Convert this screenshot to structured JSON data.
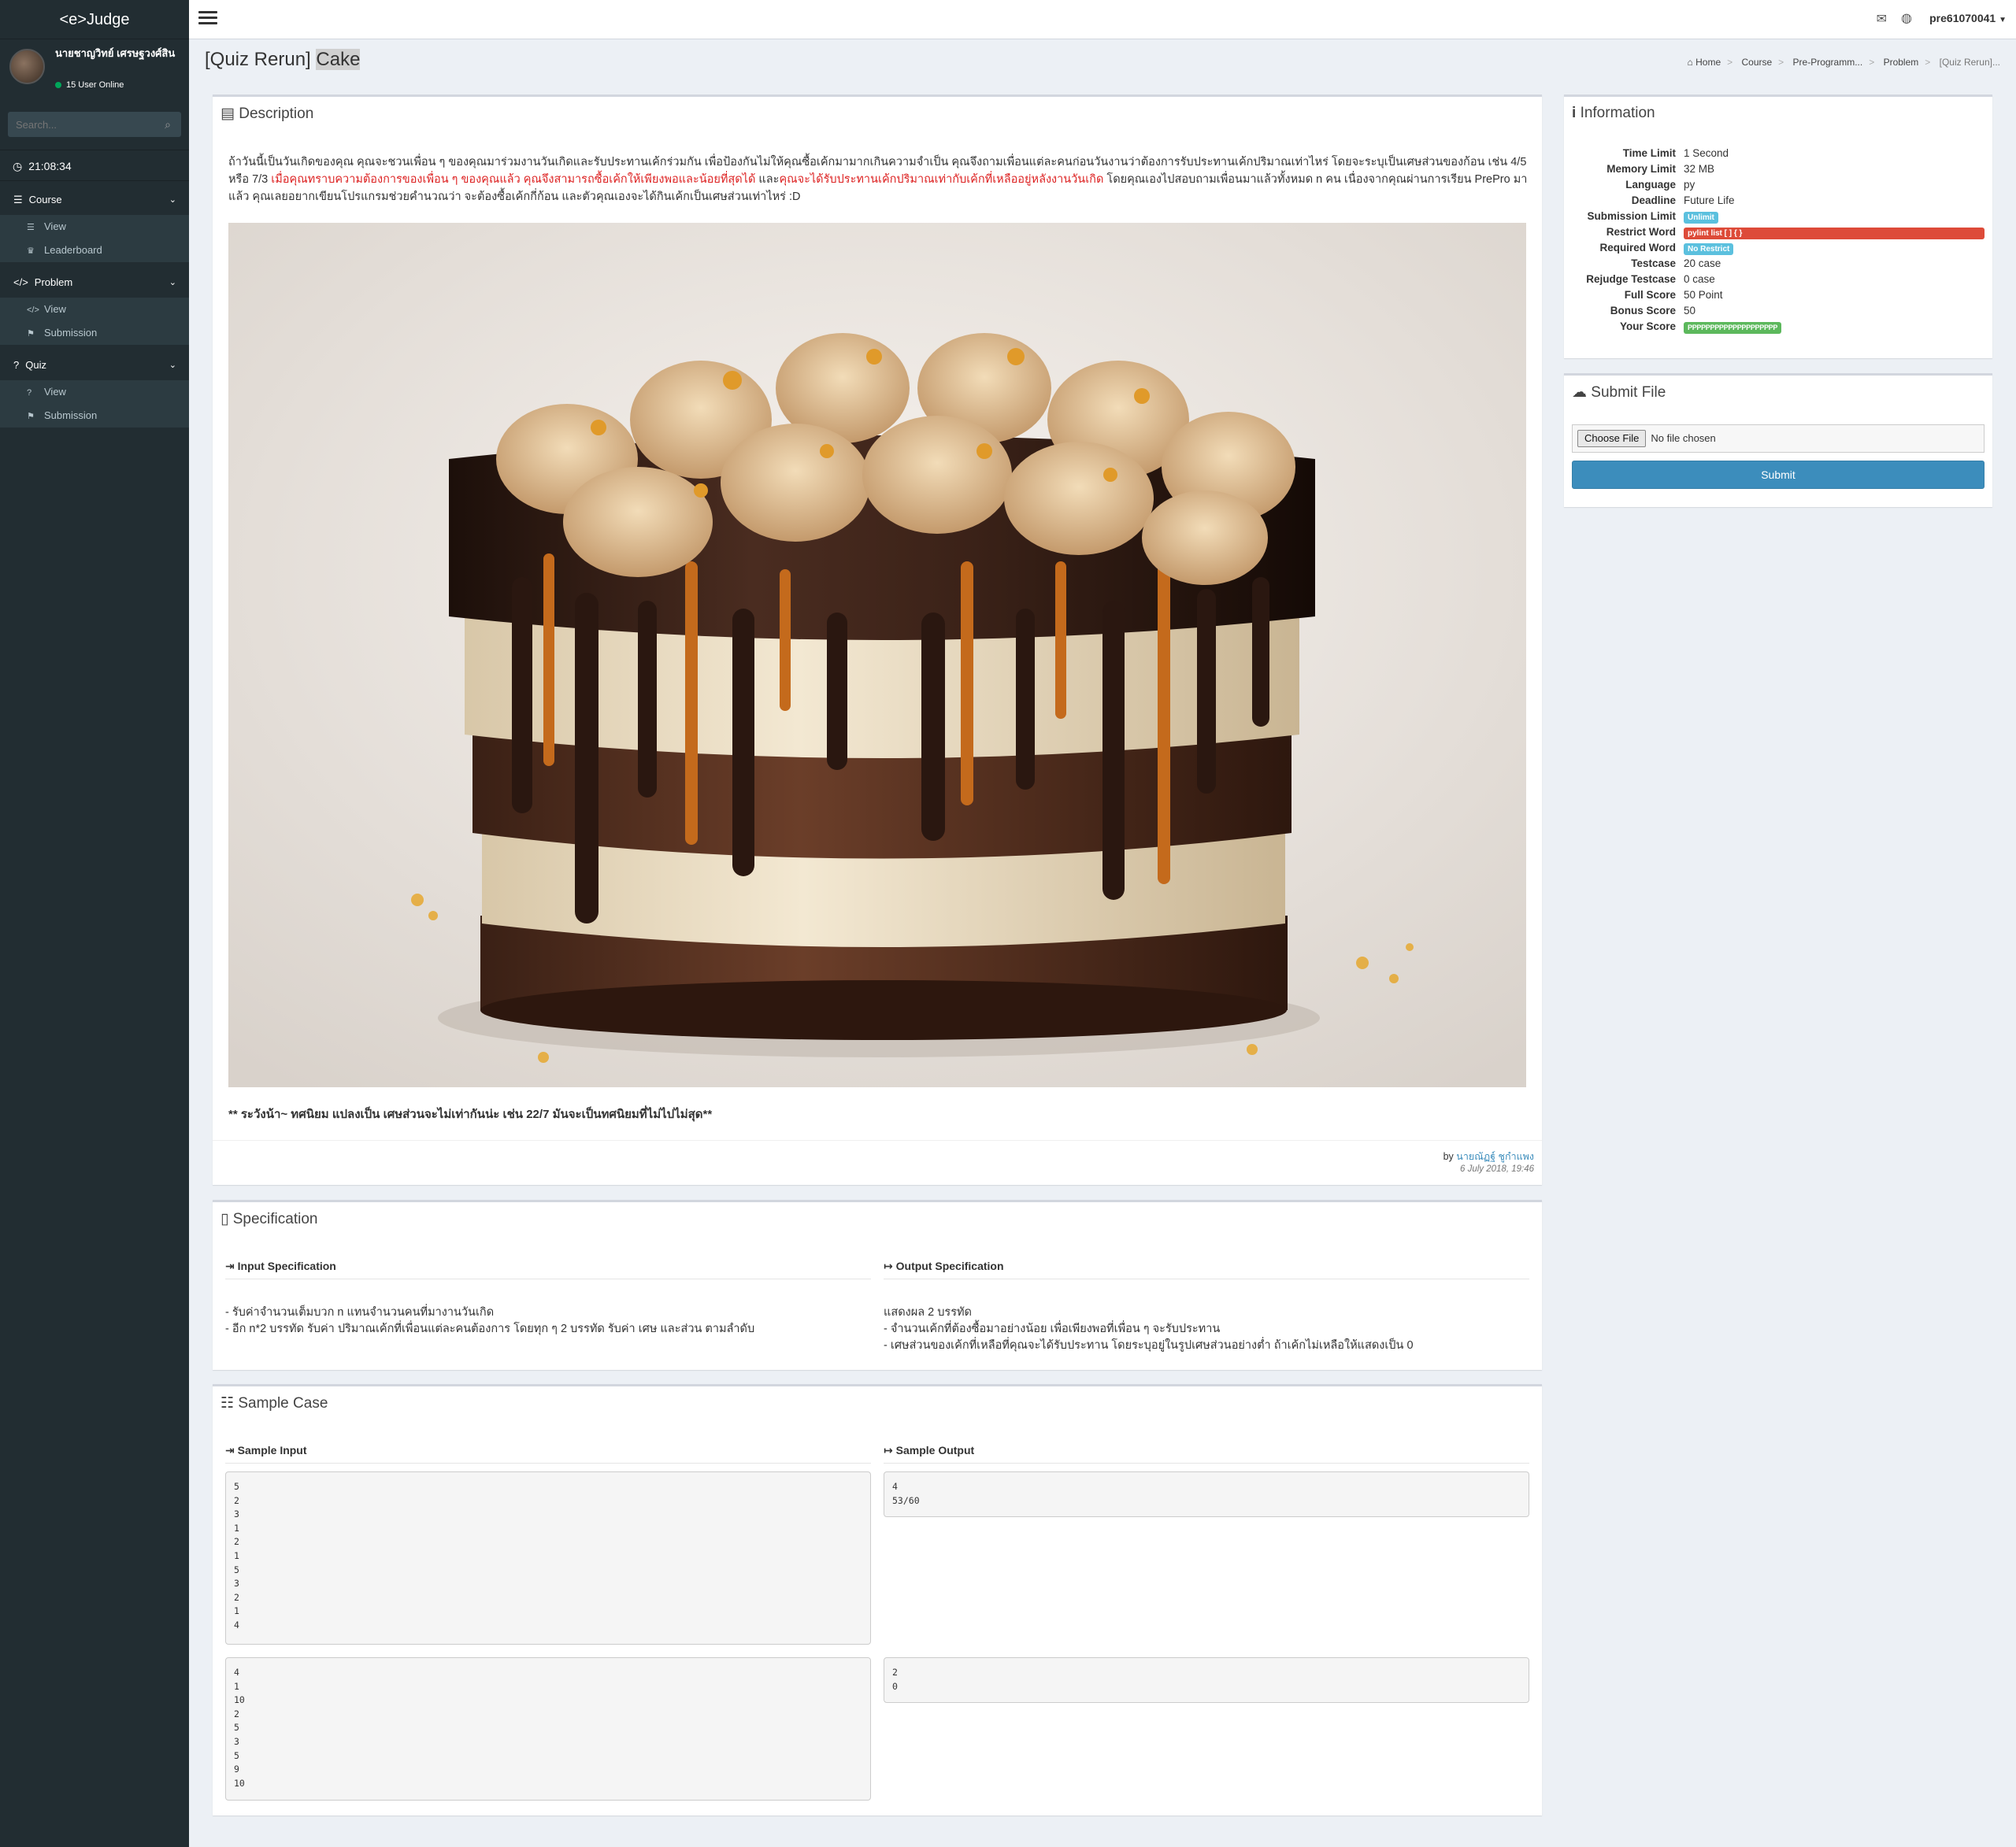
{
  "app": {
    "logo": "<e>Judge"
  },
  "user": {
    "name": "นายชาญวิทย์ เศรษฐวงศ์สิน",
    "online": "15 User Online",
    "menu_name": "pre61070041"
  },
  "search": {
    "placeholder": "Search..."
  },
  "clock": "21:08:34",
  "sidebar": {
    "sections": [
      {
        "label": "Course",
        "items": [
          "View",
          "Leaderboard"
        ]
      },
      {
        "label": "Problem",
        "items": [
          "View",
          "Submission"
        ]
      },
      {
        "label": "Quiz",
        "items": [
          "View",
          "Submission"
        ]
      }
    ]
  },
  "page": {
    "title_prefix": "[Quiz Rerun] ",
    "title_name": "Cake"
  },
  "breadcrumb": [
    "Home",
    "Course",
    "Pre-Programm...",
    "Problem",
    "[Quiz Rerun]..."
  ],
  "description": {
    "heading": "Description",
    "para_1": "ถ้าวันนี้เป็นวันเกิดของคุณ คุณจะชวนเพื่อน ๆ ของคุณมาร่วมงานวันเกิดและรับประทานเค้กร่วมกัน เพื่อป้องกันไม่ให้คุณซื้อเค้กมามากเกินความจำเป็น คุณจึงถามเพื่อนแต่ละคนก่อนวันงานว่าต้องการรับประทานเค้กปริมาณเท่าไหร่ โดยจะระบุเป็นเศษส่วนของก้อน เช่น 4/5 หรือ 7/3 ",
    "para_red_1": "เมื่อคุณทราบความต้องการของเพื่อน ๆ ของคุณแล้ว คุณจึงสามารถซื้อเค้กให้เพียงพอและน้อยที่สุดได้",
    "para_2": " และ",
    "para_red_2": "คุณจะได้รับประทานเค้กปริมาณเท่ากับเค้กที่เหลืออยู่หลังงานวันเกิด",
    "para_3": " โดยคุณเองไปสอบถามเพื่อนมาแล้วทั้งหมด n คน เนื่องจากคุณผ่านการเรียน PrePro มาแล้ว คุณเลยอยากเขียนโปรแกรมช่วยคำนวณว่า จะต้องซื้อเค้กกี่ก้อน และตัวคุณเองจะได้กินเค้กเป็นเศษส่วนเท่าไหร่ :D",
    "warning": "** ระวังน้า~ ทศนิยม แปลงเป็น เศษส่วนจะไม่เท่ากันน่ะ เช่น 22/7 มันจะเป็นทศนิยมที่ไม่ไปไม่สุด**",
    "by_label": "by ",
    "author": "นายณัฏฐ์ ชูกำแพง",
    "date": "6 July 2018, 19:46"
  },
  "specification": {
    "heading": "Specification",
    "input_heading": "Input Specification",
    "output_heading": "Output Specification",
    "input_lines": [
      "- รับค่าจำนวนเต็มบวก n แทนจำนวนคนที่มางานวันเกิด",
      "- อีก n*2 บรรทัด รับค่า ปริมาณเค้กที่เพื่อนแต่ละคนต้องการ โดยทุก ๆ 2 บรรทัด รับค่า เศษ และส่วน ตามลำดับ"
    ],
    "output_lines": [
      "แสดงผล 2 บรรทัด",
      "- จำนวนเค้กที่ต้องซื้อมาอย่างน้อย เพื่อเพียงพอที่เพื่อน ๆ จะรับประทาน",
      "- เศษส่วนของเค้กที่เหลือที่คุณจะได้รับประทาน โดยระบุอยู่ในรูปเศษส่วนอย่างต่ำ ถ้าเค้กไม่เหลือให้แสดงเป็น 0"
    ]
  },
  "sample": {
    "heading": "Sample Case",
    "input_heading": "Sample Input",
    "output_heading": "Sample Output",
    "cases": [
      {
        "input": "5\n2\n3\n1\n2\n1\n5\n3\n2\n1\n4",
        "output": "4\n53/60"
      },
      {
        "input": "4\n1\n10\n2\n5\n3\n5\n9\n10",
        "output": "2\n0"
      }
    ]
  },
  "information": {
    "heading": "Information",
    "rows": [
      {
        "label": "Time Limit",
        "value": "1 Second"
      },
      {
        "label": "Memory Limit",
        "value": "32 MB"
      },
      {
        "label": "Language",
        "value": "py"
      },
      {
        "label": "Deadline",
        "value": "Future Life"
      },
      {
        "label": "Submission Limit",
        "value": "Unlimit"
      },
      {
        "label": "Restrict Word",
        "value": "pylint list [ ] { }"
      },
      {
        "label": "Required Word",
        "value": "No Restrict"
      },
      {
        "label": "Testcase",
        "value": "20 case"
      },
      {
        "label": "Rejudge Testcase",
        "value": "0 case"
      },
      {
        "label": "Full Score",
        "value": "50 Point"
      },
      {
        "label": "Bonus Score",
        "value": "50"
      },
      {
        "label": "Your Score",
        "value": "PPPPPPPPPPPPPPPPPPPP"
      }
    ]
  },
  "submit": {
    "heading": "Submit File",
    "choose_label": "Choose File",
    "no_file": "No file chosen",
    "button": "Submit"
  },
  "colors": {
    "sidebar": "#222d32",
    "primary": "#3c8dbc",
    "danger": "#dd4b39",
    "info": "#5bc0de",
    "success": "#5cb85c"
  }
}
